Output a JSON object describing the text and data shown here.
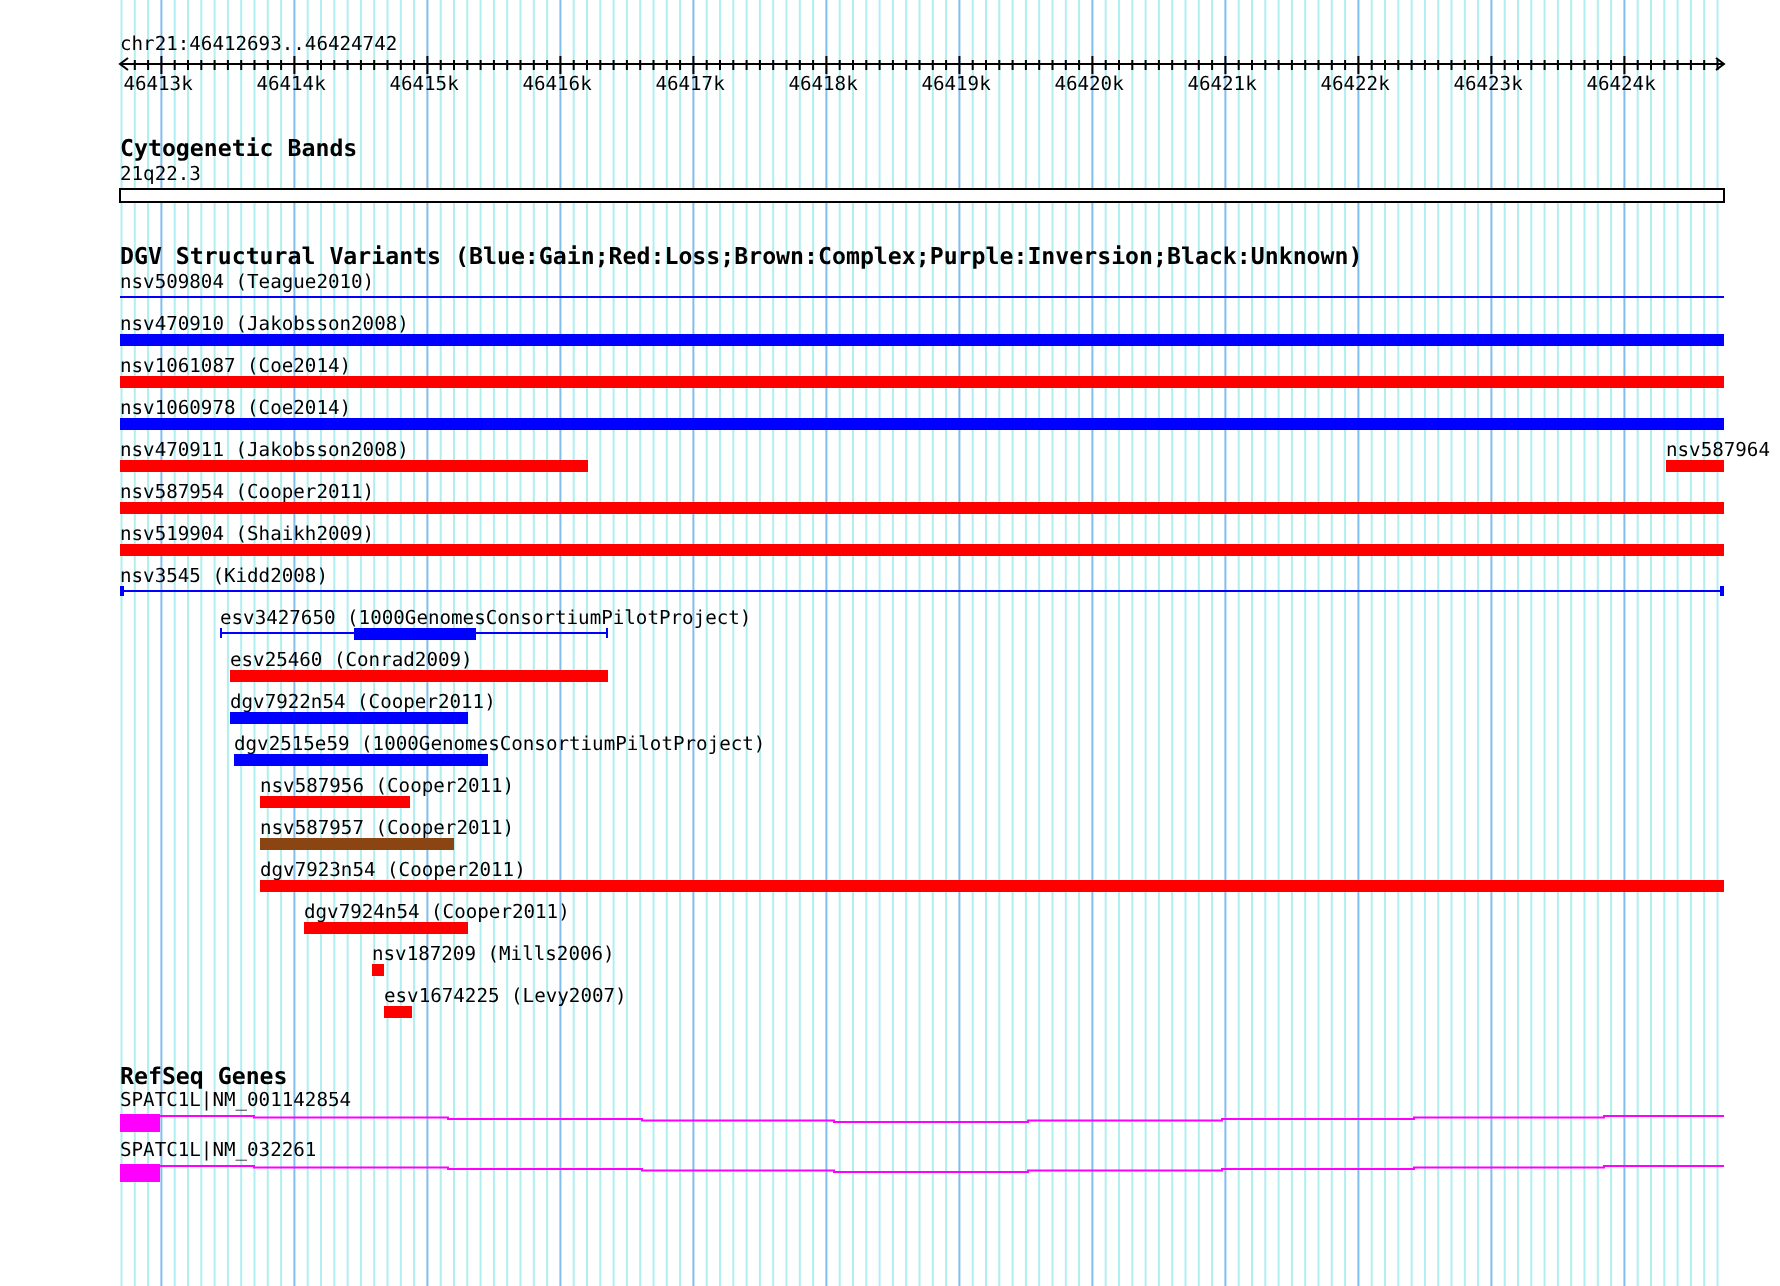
{
  "ruler": {
    "region": "chr21:46412693..46424742",
    "ticks": [
      "46413k",
      "46414k",
      "46415k",
      "46416k",
      "46417k",
      "46418k",
      "46419k",
      "46420k",
      "46421k",
      "46422k",
      "46423k",
      "46424k"
    ]
  },
  "tracks": [
    {
      "kind": "cytoband",
      "title": "Cytogenetic Bands",
      "features": [
        {
          "label": "21q22.3"
        }
      ]
    },
    {
      "kind": "variants",
      "title": "DGV Structural Variants (Blue:Gain;Red:Loss;Brown:Complex;Purple:Inversion;Black:Unknown)",
      "features": [
        {
          "label": "nsv509804 (Teague2010)",
          "color": "#0000ff"
        },
        {
          "label": "nsv470910 (Jakobsson2008)",
          "color": "#0000ff"
        },
        {
          "label": "nsv1061087 (Coe2014)",
          "color": "#ff0000"
        },
        {
          "label": "nsv1060978 (Coe2014)",
          "color": "#0000ff"
        },
        {
          "label": "nsv470911 (Jakobsson2008)",
          "color": "#ff0000"
        },
        {
          "label": "nsv587964",
          "color": "#ff0000"
        },
        {
          "label": "nsv587954 (Cooper2011)",
          "color": "#ff0000"
        },
        {
          "label": "nsv519904 (Shaikh2009)",
          "color": "#ff0000"
        },
        {
          "label": "nsv3545 (Kidd2008)",
          "color": "#0000ff"
        },
        {
          "label": "esv3427650 (1000GenomesConsortiumPilotProject)",
          "color": "#0000ff"
        },
        {
          "label": "esv25460 (Conrad2009)",
          "color": "#ff0000"
        },
        {
          "label": "dgv7922n54 (Cooper2011)",
          "color": "#0000ff"
        },
        {
          "label": "dgv2515e59 (1000GenomesConsortiumPilotProject)",
          "color": "#0000ff"
        },
        {
          "label": "nsv587956 (Cooper2011)",
          "color": "#ff0000"
        },
        {
          "label": "nsv587957 (Cooper2011)",
          "color": "#8b4513"
        },
        {
          "label": "dgv7923n54 (Cooper2011)",
          "color": "#ff0000"
        },
        {
          "label": "dgv7924n54 (Cooper2011)",
          "color": "#ff0000"
        },
        {
          "label": "nsv187209 (Mills2006)",
          "color": "#ff0000"
        },
        {
          "label": "esv1674225 (Levy2007)",
          "color": "#ff0000"
        }
      ]
    },
    {
      "kind": "genes",
      "title": "RefSeq Genes",
      "features": [
        {
          "label": "SPATC1L|NM_001142854",
          "color": "#ff00ff"
        },
        {
          "label": "SPATC1L|NM_032261",
          "color": "#ff00ff"
        }
      ]
    }
  ]
}
